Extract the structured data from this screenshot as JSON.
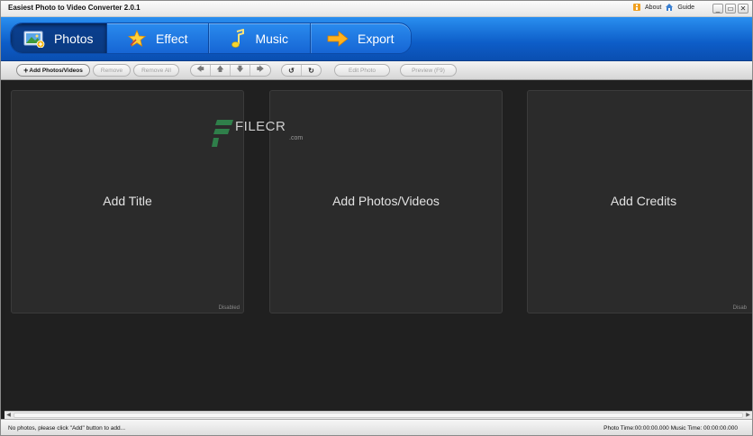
{
  "window": {
    "title": "Easiest Photo to Video Converter 2.0.1",
    "about_label": "About",
    "guide_label": "Guide",
    "minimize": "_",
    "restore": "▭",
    "close": "✕"
  },
  "tabs": [
    {
      "label": "Photos",
      "icon": "photos-icon",
      "active": true
    },
    {
      "label": "Effect",
      "icon": "effect-star-icon",
      "active": false
    },
    {
      "label": "Music",
      "icon": "music-note-icon",
      "active": false
    },
    {
      "label": "Export",
      "icon": "export-arrow-icon",
      "active": false
    }
  ],
  "toolbar": {
    "add_label": "Add Photos/Videos",
    "remove_label": "Remove",
    "remove_all_label": "Remove All",
    "move_left": "🡄",
    "move_up": "🡅",
    "move_down": "🡇",
    "move_right": "🡆",
    "rotate_left": "↺",
    "rotate_right": "↻",
    "edit_photo_label": "Edit Photo",
    "preview_label": "Preview (F9)"
  },
  "panels": {
    "title_panel": {
      "label": "Add Title",
      "status": "Disabled"
    },
    "photos_panel": {
      "label": "Add Photos/Videos"
    },
    "credits_panel": {
      "label": "Add Credits",
      "status": "Disab"
    }
  },
  "watermark": {
    "text": "FILECR",
    "suffix": ".com"
  },
  "scrollbar": {
    "left_arrow": "◀",
    "right_arrow": "▶"
  },
  "status": {
    "message": "No photos, please click \"Add\" button to add...",
    "times": "Photo Time:00:00:00.000   Music Time:  00:00:00.000"
  },
  "colors": {
    "tab_bar_blue": "#0d5dc8",
    "active_tab": "#0a3a82",
    "workspace": "#202020",
    "panel": "#2b2b2b"
  }
}
